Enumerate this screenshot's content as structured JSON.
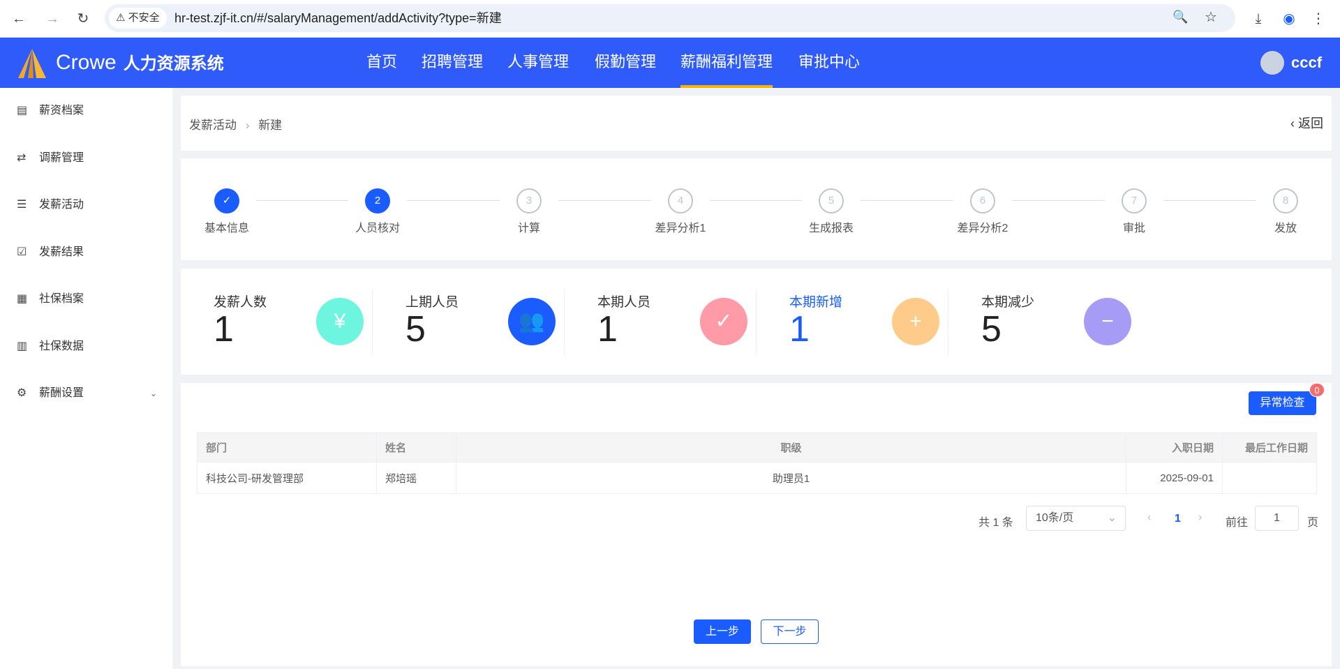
{
  "browser": {
    "security": "不安全",
    "url": "hr-test.zjf-it.cn/#/salaryManagement/addActivity?type=新建"
  },
  "header": {
    "brand": "Crowe",
    "system": "人力资源系统",
    "user": "cccf",
    "nav": [
      {
        "label": "首页"
      },
      {
        "label": "招聘管理"
      },
      {
        "label": "人事管理"
      },
      {
        "label": "假勤管理"
      },
      {
        "label": "薪酬福利管理",
        "active": true
      },
      {
        "label": "审批中心"
      }
    ]
  },
  "sidebar": {
    "items": [
      {
        "label": "薪资档案",
        "icon": "document-icon"
      },
      {
        "label": "调薪管理",
        "icon": "exchange-icon"
      },
      {
        "label": "发薪活动",
        "icon": "list-icon"
      },
      {
        "label": "发薪结果",
        "icon": "clipboard-check-icon"
      },
      {
        "label": "社保档案",
        "icon": "grid-icon"
      },
      {
        "label": "社保数据",
        "icon": "bar-chart-icon"
      },
      {
        "label": "薪酬设置",
        "icon": "gear-icon"
      }
    ]
  },
  "breadcrumb": {
    "parent": "发薪活动",
    "current": "新建",
    "back": "返回"
  },
  "steps": [
    {
      "n": "1",
      "label": "基本信息",
      "state": "done"
    },
    {
      "n": "2",
      "label": "人员核对",
      "state": "cur"
    },
    {
      "n": "3",
      "label": "计算"
    },
    {
      "n": "4",
      "label": "差异分析1"
    },
    {
      "n": "5",
      "label": "生成报表"
    },
    {
      "n": "6",
      "label": "差异分析2"
    },
    {
      "n": "7",
      "label": "审批"
    },
    {
      "n": "8",
      "label": "发放"
    }
  ],
  "stats": [
    {
      "label": "发薪人数",
      "value": "1",
      "color": "#6df5e0",
      "glyph": "¥"
    },
    {
      "label": "上期人员",
      "value": "5",
      "color": "#1a5cff",
      "glyph": "👥"
    },
    {
      "label": "本期人员",
      "value": "1",
      "color": "#ff9aa6",
      "glyph": "✓"
    },
    {
      "label": "本期新增",
      "value": "1",
      "color": "#ffcb8a",
      "glyph": "+",
      "highlight": true
    },
    {
      "label": "本期减少",
      "value": "5",
      "color": "#a79cf5",
      "glyph": "−"
    }
  ],
  "table": {
    "check_button": "异常检查",
    "badge": "0",
    "headers": [
      "部门",
      "姓名",
      "职级",
      "入职日期",
      "最后工作日期"
    ],
    "rows": [
      [
        "科技公司-研发管理部",
        "郑培瑶",
        "助理员1",
        "2025-09-01",
        ""
      ]
    ]
  },
  "pagination": {
    "total": "共 1 条",
    "page_size": "10条/页",
    "current": "1",
    "goto": "前往",
    "goto_value": "1",
    "page_suffix": "页"
  },
  "footer": {
    "prev": "上一步",
    "next": "下一步"
  }
}
